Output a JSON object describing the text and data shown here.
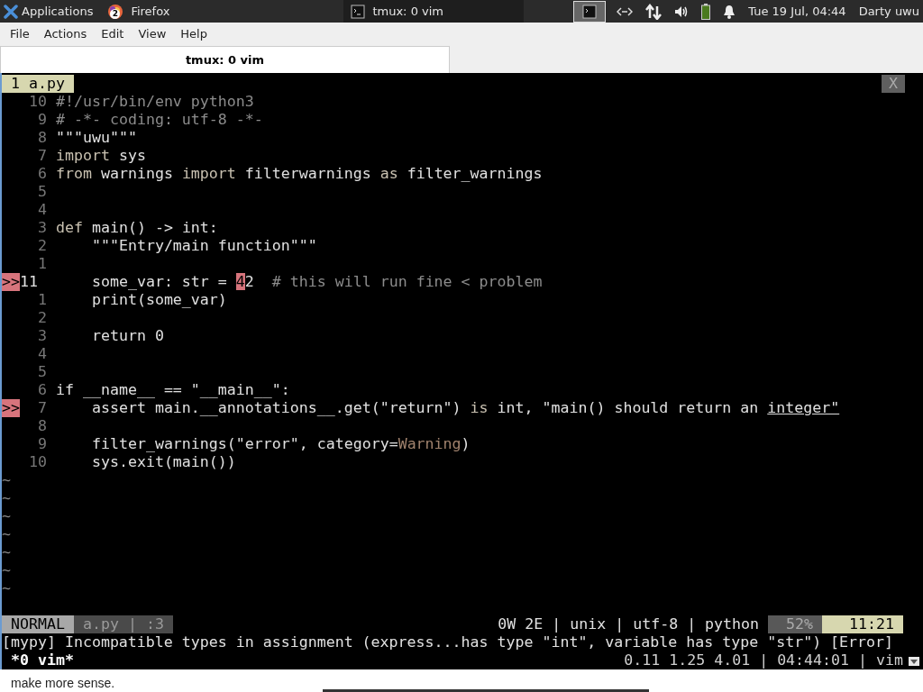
{
  "panel": {
    "apps_label": "Applications",
    "tasks": [
      {
        "label": "Firefox",
        "kind": "browser",
        "badge": "2",
        "selected": false
      },
      {
        "label": "tmux: 0 vim",
        "kind": "terminal",
        "selected": true
      }
    ],
    "clock": "Tue 19 Jul, 04:44",
    "user": "Darty uwu"
  },
  "menu": [
    "File",
    "Actions",
    "Edit",
    "View",
    "Help"
  ],
  "tabs": [
    {
      "label": "tmux: 0 vim",
      "selected": true
    }
  ],
  "vim": {
    "buffer_tab": "1 a.py",
    "close_label": "X",
    "lines": [
      {
        "num": "10",
        "segs": [
          {
            "t": "#!/usr/bin/env python3",
            "kind": "comment"
          }
        ]
      },
      {
        "num": "9",
        "segs": [
          {
            "t": "# -*- coding: utf-8 -*-",
            "kind": "comment"
          }
        ]
      },
      {
        "num": "8",
        "segs": [
          {
            "t": "\"\"\"uwu\"\"\"",
            "kind": "plain"
          }
        ]
      },
      {
        "num": "7",
        "segs": [
          {
            "t": "import",
            "kind": "keyword"
          },
          {
            "t": " sys",
            "kind": "plain"
          }
        ]
      },
      {
        "num": "6",
        "segs": [
          {
            "t": "from",
            "kind": "keyword"
          },
          {
            "t": " warnings ",
            "kind": "plain"
          },
          {
            "t": "import",
            "kind": "keyword"
          },
          {
            "t": " filterwarnings ",
            "kind": "plain"
          },
          {
            "t": "as",
            "kind": "keyword"
          },
          {
            "t": " filter_warnings",
            "kind": "plain"
          }
        ]
      },
      {
        "num": "5"
      },
      {
        "num": "4"
      },
      {
        "num": "3",
        "segs": [
          {
            "t": "def",
            "kind": "keyword"
          },
          {
            "t": " main() -> int:",
            "kind": "plain"
          }
        ]
      },
      {
        "num": "2",
        "segs": [
          {
            "t": "    \"\"\"Entry/main function\"\"\"",
            "kind": "plain"
          }
        ]
      },
      {
        "num": "1"
      },
      {
        "num": "11",
        "sign": ">>",
        "current": true,
        "segs": [
          {
            "t": "    some_var: str = ",
            "kind": "plain"
          },
          {
            "t": "4",
            "kind": "error"
          },
          {
            "t": "2  ",
            "kind": "plain"
          },
          {
            "t": "# this will run fine < problem",
            "kind": "comment"
          }
        ]
      },
      {
        "num": "1",
        "segs": [
          {
            "t": "    print(some_var)",
            "kind": "plain"
          }
        ]
      },
      {
        "num": "2"
      },
      {
        "num": "3",
        "segs": [
          {
            "t": "    return 0",
            "kind": "plain"
          }
        ]
      },
      {
        "num": "4"
      },
      {
        "num": "5"
      },
      {
        "num": "6",
        "segs": [
          {
            "t": "if __name__ == \"__main__\":",
            "kind": "plain"
          }
        ]
      },
      {
        "num": "7",
        "sign": ">>",
        "segs": [
          {
            "t": "    assert main.__annotations__.get(\"return\") ",
            "kind": "plain"
          },
          {
            "t": "is",
            "kind": "keyword"
          },
          {
            "t": " int, \"main() should return an ",
            "kind": "plain"
          },
          {
            "t": "integer\"",
            "kind": "underline"
          }
        ]
      },
      {
        "num": "8"
      },
      {
        "num": "9",
        "segs": [
          {
            "t": "    filter_warnings(\"error\", category=",
            "kind": "plain"
          },
          {
            "t": "Warning",
            "kind": "builtin"
          },
          {
            "t": ")",
            "kind": "plain"
          }
        ]
      },
      {
        "num": "10",
        "segs": [
          {
            "t": "    sys.exit(main())",
            "kind": "plain"
          }
        ]
      }
    ],
    "tildes": [
      "~",
      "~",
      "~",
      "~",
      "~",
      "~",
      "~"
    ],
    "status": {
      "mode": "NORMAL",
      "file": "a.py | :3",
      "info": "0W 2E | unix | utf-8 | python",
      "percent": "52%",
      "position": "11:21"
    },
    "message": "[mypy] Incompatible types in assignment (express...has type \"int\", variable has type \"str\") [Error]"
  },
  "tmux": {
    "window": "*0 vim*",
    "right": "0.11 1.25 4.01 | 04:44:01 | vim"
  },
  "below": {
    "text": "make more sense."
  }
}
